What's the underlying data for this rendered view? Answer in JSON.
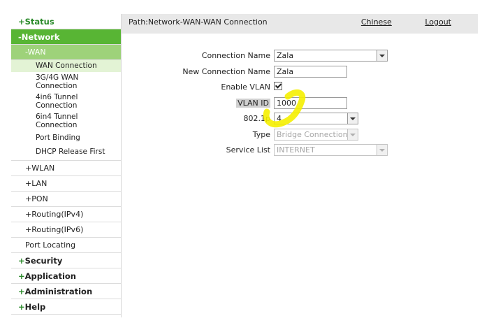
{
  "sidebar": {
    "status": "+Status",
    "network": "-Network",
    "wan": "-WAN",
    "wan_items": [
      "WAN Connection",
      "3G/4G WAN Connection",
      "4in6 Tunnel Connection",
      "6in4 Tunnel Connection",
      "Port Binding",
      "DHCP Release First"
    ],
    "wlan": "+WLAN",
    "lan": "+LAN",
    "pon": "+PON",
    "routing_ipv4": "+Routing(IPv4)",
    "routing_ipv6": "+Routing(IPv6)",
    "port_locating": "Port Locating",
    "security": "Security",
    "application": "Application",
    "administration": "Administration",
    "help": "Help",
    "plus": "+"
  },
  "header": {
    "path": "Path:Network-WAN-WAN Connection",
    "chinese": "Chinese",
    "logout": "Logout"
  },
  "form": {
    "connection_name_label": "Connection Name",
    "connection_name_value": "Zala",
    "new_connection_name_label": "New Connection Name",
    "new_connection_name_value": "Zala",
    "enable_vlan_label": "Enable VLAN",
    "enable_vlan_checked": true,
    "vlan_id_label": "VLAN ID",
    "vlan_id_value": "1000",
    "priority_label": "802.1p",
    "priority_value": "4",
    "type_label": "Type",
    "type_value": "Bridge Connection",
    "service_list_label": "Service List",
    "service_list_value": "INTERNET"
  },
  "colors": {
    "network_active": "#58b534",
    "wan_active": "#9ed27a",
    "selected_item": "#e3f3d5",
    "highlighter": "#ffff00"
  }
}
